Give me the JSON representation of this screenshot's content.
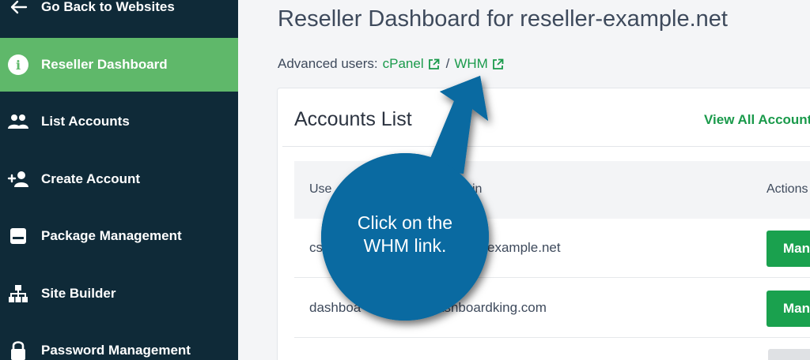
{
  "sidebar": {
    "items": [
      {
        "label": "Go Back to Websites",
        "icon": "arrow-left-icon"
      },
      {
        "label": "Reseller Dashboard",
        "icon": "info-icon",
        "active": true
      },
      {
        "label": "List Accounts",
        "icon": "users-icon"
      },
      {
        "label": "Create Account",
        "icon": "add-user-icon"
      },
      {
        "label": "Package Management",
        "icon": "package-icon"
      },
      {
        "label": "Site Builder",
        "icon": "sitemap-icon"
      },
      {
        "label": "Password Management",
        "icon": "lock-icon"
      }
    ]
  },
  "main": {
    "title": "Reseller Dashboard for reseller-example.net",
    "advanced_label": "Advanced users:",
    "cpanel_link": "cPanel",
    "separator": "/",
    "whm_link": "WHM"
  },
  "accounts": {
    "title": "Accounts List",
    "view_all": "View All Accounts",
    "headers": [
      "Use",
      "in",
      "Actions"
    ],
    "rows": [
      {
        "user": "cs",
        "domain": "example.net",
        "action": "Manage"
      },
      {
        "user": "dashboa",
        "domain": "ashboardking.com",
        "action": "Manage"
      }
    ]
  },
  "callout": {
    "text_line1": "Click on the",
    "text_line2": "WHM link."
  },
  "colors": {
    "sidebar_bg": "#0f2a38",
    "active_item": "#5fb86a",
    "link_green": "#1a9a4b",
    "button_green": "#1aa14e",
    "callout_blue": "#0a6aa1"
  }
}
